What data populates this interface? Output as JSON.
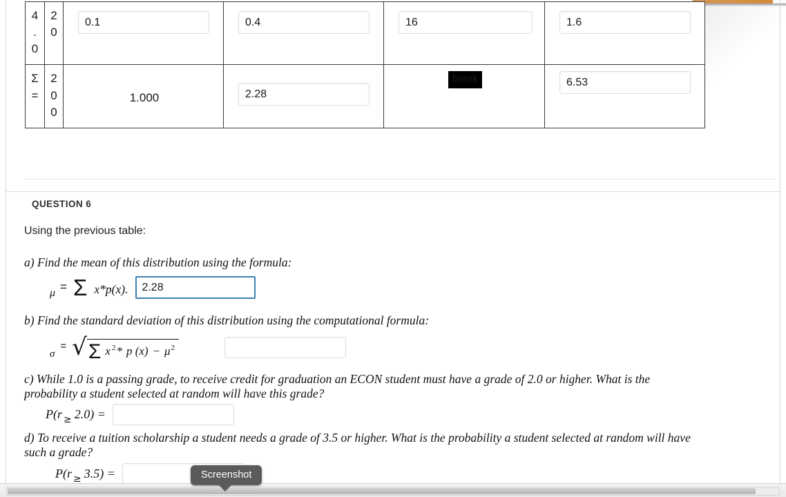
{
  "window": {
    "accent_orange": "#d8862a",
    "focus_blue": "#3c7fb1"
  },
  "table": {
    "rows": [
      {
        "x": [
          "4",
          ".",
          "0"
        ],
        "f": [
          "2",
          "0"
        ],
        "p_of_x": "0.1",
        "x_times_p": "0.4",
        "x_squared": "16",
        "x2_times_p": "1.6"
      },
      {
        "x": [
          "Σ",
          "="
        ],
        "f": [
          "2",
          "0",
          "0"
        ],
        "p_of_x_total": "1.000",
        "x_times_p_total": "2.28",
        "x_squared_total": "blank",
        "x2_times_p_total": "6.53"
      }
    ]
  },
  "question": {
    "heading": "QUESTION 6",
    "intro": "Using the previous table:",
    "parts": {
      "a": {
        "prompt": "a) Find the mean of this distribution using the formula:",
        "symbol_mu": "μ",
        "symbol_equals": "=",
        "symbol_sum": "Σ",
        "formula_tail": "x*p(x).",
        "answer": "2.28"
      },
      "b": {
        "prompt": "b) Find the standard deviation of this distribution using the computational formula:",
        "symbol_sigma": "σ",
        "symbol_equals": "=",
        "symbol_sum": "Σ",
        "radicand_x": "x",
        "radicand_exp": "2",
        "radicand_mid": "*",
        "radicand_px": "p (x)",
        "radicand_minus": "−",
        "radicand_mu": "μ",
        "radicand_mu_exp": "2",
        "answer": ""
      },
      "c": {
        "prompt": "c) While 1.0 is a passing grade, to receive credit for graduation an ECON student must have a grade of 2.0 or higher.  What is the probability a student selected at random will have this grade?",
        "label_prefix": "P(r",
        "label_ge": "≥",
        "label_suffix": "2.0) =",
        "answer": ""
      },
      "d": {
        "prompt": "d) To receive a tuition scholarship a student needs a grade of 3.5 or higher.  What is the probability a student selected at random will have such a grade?",
        "label_prefix": "P(r",
        "label_ge": "≥",
        "label_suffix": "3.5) =",
        "answer": ""
      }
    }
  },
  "tooltip": {
    "label": "Screenshot"
  }
}
